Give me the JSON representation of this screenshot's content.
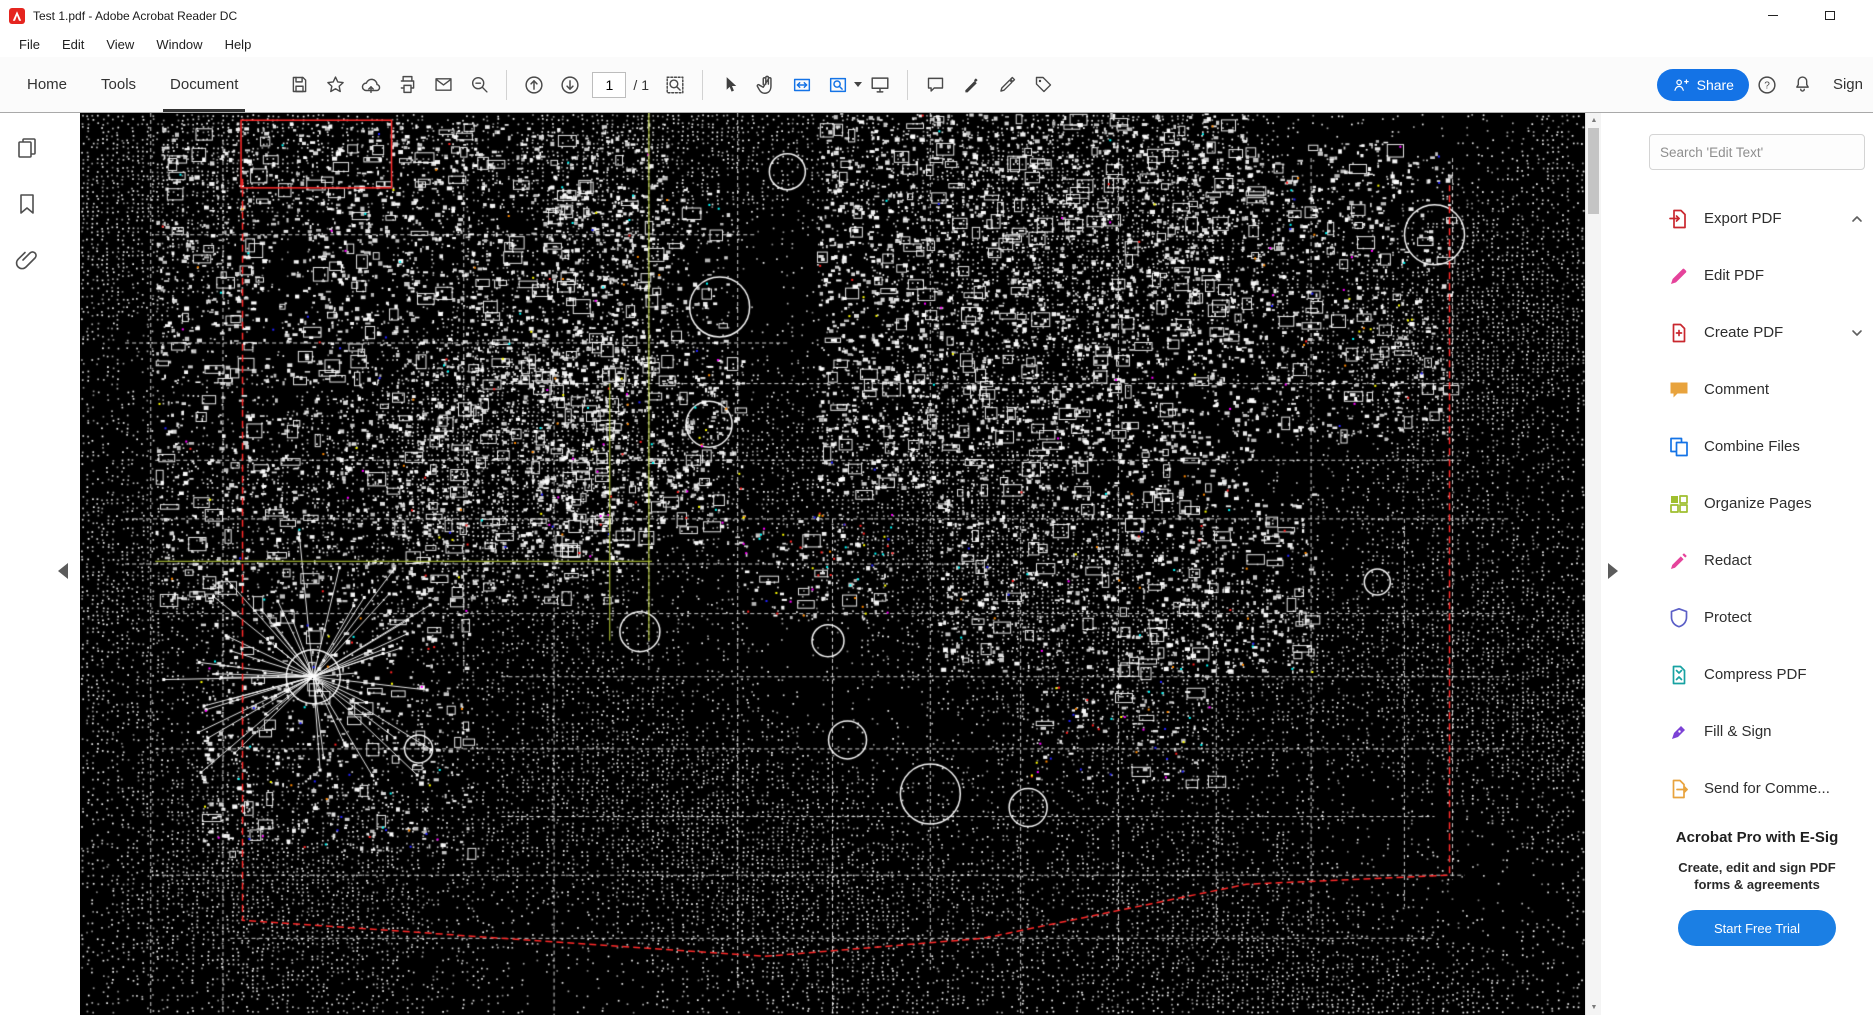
{
  "window": {
    "title": "Test 1.pdf - Adobe Acrobat Reader DC",
    "controls": {
      "minimize": "minimize",
      "maximize": "maximize",
      "close": "close"
    }
  },
  "menu": {
    "items": [
      "File",
      "Edit",
      "View",
      "Window",
      "Help"
    ]
  },
  "tabs": {
    "home": "Home",
    "tools": "Tools",
    "document": "Document",
    "active": "Document"
  },
  "toolbar": {
    "page_current": "1",
    "page_total_label": "/ 1",
    "share_label": "Share",
    "sign_label": "Sign",
    "icons": [
      "save",
      "star",
      "send-to-cloud",
      "print",
      "email",
      "zoom-out",
      "page-up",
      "page-down",
      "find",
      "select-tool",
      "hand-tool",
      "marquee-zoom",
      "zoom-options",
      "reading-mode",
      "comment",
      "highlight",
      "sign-pen",
      "tag",
      "share-person",
      "help",
      "notifications"
    ]
  },
  "left_rail": {
    "icons": [
      "page-thumbnails",
      "bookmarks",
      "attachments"
    ]
  },
  "document": {
    "colors": {
      "background": "#000000",
      "ink": "#ffffff",
      "boundary": "#ff2a2a",
      "survey_line": "#b9cf35"
    }
  },
  "right_panel": {
    "search_placeholder": "Search 'Edit Text'",
    "tools": [
      {
        "label": "Export PDF",
        "color": "#c9272e",
        "chevron": "up"
      },
      {
        "label": "Edit PDF",
        "color": "#e5439b"
      },
      {
        "label": "Create PDF",
        "color": "#c9272e",
        "chevron": "down"
      },
      {
        "label": "Comment",
        "color": "#e8a33d"
      },
      {
        "label": "Combine Files",
        "color": "#1473e6"
      },
      {
        "label": "Organize Pages",
        "color": "#9fbf2e"
      },
      {
        "label": "Redact",
        "color": "#e5439b"
      },
      {
        "label": "Protect",
        "color": "#5b5fc7"
      },
      {
        "label": "Compress PDF",
        "color": "#17a2a2"
      },
      {
        "label": "Fill & Sign",
        "color": "#7c42d6"
      },
      {
        "label": "Send for Comme...",
        "color": "#e8a33d"
      }
    ],
    "promo": {
      "title": "Acrobat Pro with E-Sig",
      "desc_line1": "Create, edit and sign PDF",
      "desc_line2": "forms & agreements",
      "cta": "Start Free Trial"
    }
  }
}
